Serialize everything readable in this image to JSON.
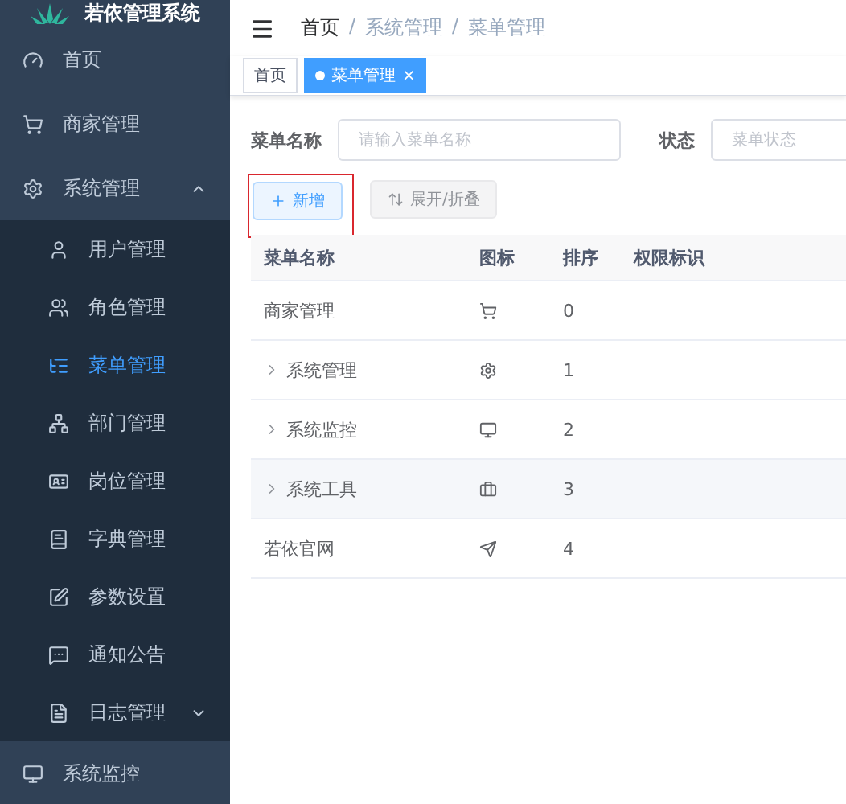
{
  "sidebar": {
    "title": "若依管理系统",
    "items": [
      {
        "kind": "top",
        "label": "首页",
        "selected": false
      },
      {
        "kind": "top",
        "label": "商家管理",
        "selected": false
      },
      {
        "kind": "group",
        "label": "系统管理",
        "selected": false,
        "expanded": true
      },
      {
        "kind": "sub",
        "label": "用户管理",
        "selected": false
      },
      {
        "kind": "sub",
        "label": "角色管理",
        "selected": false
      },
      {
        "kind": "sub",
        "label": "菜单管理",
        "selected": true
      },
      {
        "kind": "sub",
        "label": "部门管理",
        "selected": false
      },
      {
        "kind": "sub",
        "label": "岗位管理",
        "selected": false
      },
      {
        "kind": "sub",
        "label": "字典管理",
        "selected": false
      },
      {
        "kind": "sub",
        "label": "参数设置",
        "selected": false
      },
      {
        "kind": "sub",
        "label": "通知公告",
        "selected": false
      },
      {
        "kind": "subgroup",
        "label": "日志管理",
        "selected": false,
        "expanded": false
      },
      {
        "kind": "top",
        "label": "系统监控",
        "selected": false
      }
    ]
  },
  "breadcrumb": {
    "separator": "/",
    "items": [
      "首页",
      "系统管理",
      "菜单管理"
    ]
  },
  "tags": [
    {
      "label": "首页",
      "selected": false
    },
    {
      "label": "菜单管理",
      "selected": true,
      "close": "×"
    }
  ],
  "filters": [
    {
      "label": "菜单名称",
      "placeholder": "请输入菜单名称"
    },
    {
      "label": "状态",
      "placeholder": "菜单状态"
    }
  ],
  "buttons": [
    {
      "label": "新增",
      "kind": "primary",
      "highlighted": true
    },
    {
      "label": "展开/折叠",
      "kind": "plain",
      "highlighted": false
    }
  ],
  "table": {
    "columns": [
      "菜单名称",
      "图标",
      "排序",
      "权限标识"
    ],
    "rows": [
      {
        "name": "商家管理",
        "order": "0",
        "expandable": false,
        "hovered": false
      },
      {
        "name": "系统管理",
        "order": "1",
        "expandable": true,
        "hovered": false
      },
      {
        "name": "系统监控",
        "order": "2",
        "expandable": true,
        "hovered": false
      },
      {
        "name": "系统工具",
        "order": "3",
        "expandable": true,
        "hovered": true
      },
      {
        "name": "若依官网",
        "order": "4",
        "expandable": false,
        "hovered": false
      }
    ]
  }
}
